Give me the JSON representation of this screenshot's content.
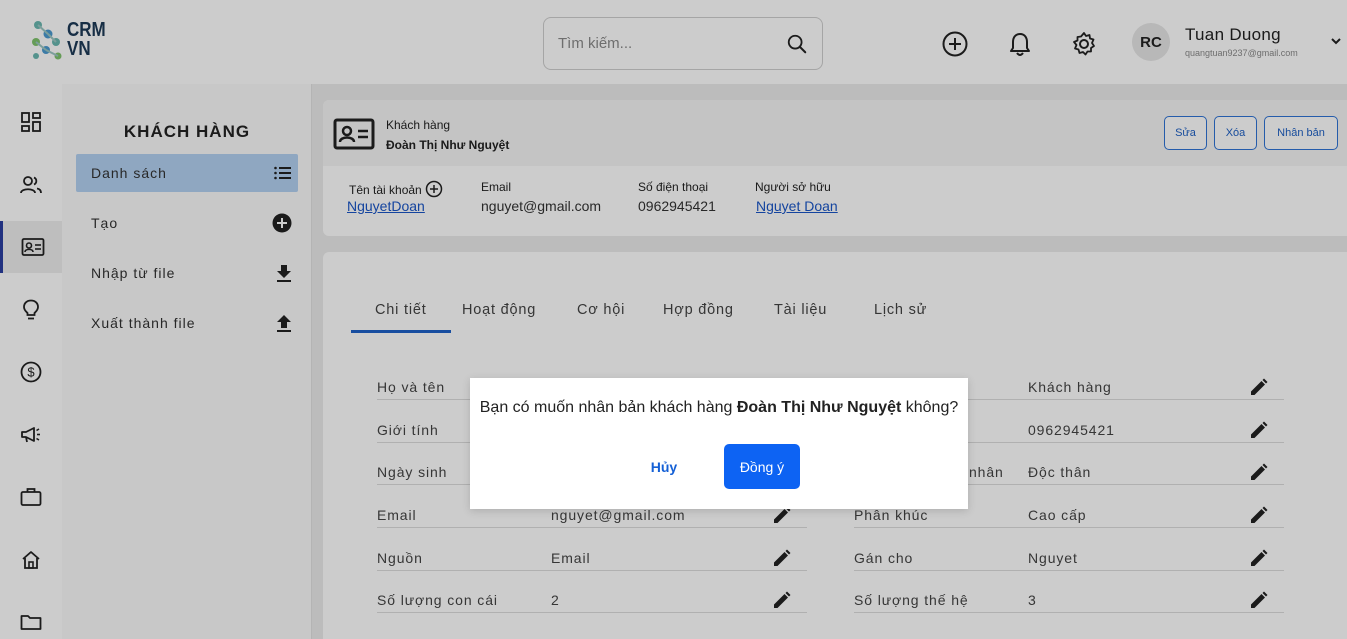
{
  "header": {
    "logo_line1": "CRM",
    "logo_line2": "VN",
    "search_placeholder": "Tìm kiếm...",
    "user": {
      "initials": "RC",
      "name": "Tuan Duong",
      "email": "quangtuan9237@gmail.com"
    },
    "icons": [
      "add-circle-icon",
      "bell-icon",
      "gear-icon",
      "chevron-down-icon",
      "search-icon"
    ]
  },
  "rail": {
    "icons": [
      "dashboard-icon",
      "users-icon",
      "contact-card-icon",
      "lightbulb-icon",
      "dollar-icon",
      "megaphone-icon",
      "briefcase-icon",
      "home-icon",
      "folder-icon"
    ],
    "active_index": 2
  },
  "sidemenu": {
    "title": "KHÁCH HÀNG",
    "items": [
      {
        "label": "Danh sách",
        "icon": "list-icon"
      },
      {
        "label": "Tạo",
        "icon": "add-filled-icon"
      },
      {
        "label": "Nhập từ file",
        "icon": "download-icon"
      },
      {
        "label": "Xuất thành file",
        "icon": "upload-icon"
      }
    ]
  },
  "customer": {
    "type_label": "Khách hàng",
    "name": "Đoàn Thị Như Nguyệt",
    "buttons": {
      "edit": "Sửa",
      "delete": "Xóa",
      "clone": "Nhân bản"
    },
    "info": {
      "account_label": "Tên tài khoản",
      "account_value": "NguyetDoan",
      "email_label": "Email",
      "email_value": "nguyet@gmail.com",
      "phone_label": "Số điện thoại",
      "phone_value": "0962945421",
      "owner_label": "Người sở hữu",
      "owner_value": "Nguyet Doan"
    }
  },
  "tabs": [
    "Chi tiết",
    "Hoạt động",
    "Cơ hội",
    "Hợp đồng",
    "Tài liệu",
    "Lịch sử"
  ],
  "details": {
    "left": [
      {
        "label": "Họ và tên",
        "value": ""
      },
      {
        "label": "Giới tính",
        "value": ""
      },
      {
        "label": "Ngày sinh",
        "value": ""
      },
      {
        "label": "Email",
        "value": "nguyet@gmail.com"
      },
      {
        "label": "Nguồn",
        "value": "Email"
      },
      {
        "label": "Số lượng con cái",
        "value": "2"
      }
    ],
    "right": [
      {
        "label": "",
        "value": "Khách hàng"
      },
      {
        "label": "",
        "value": "0962945421"
      },
      {
        "label": "nhân",
        "value": "Độc thân"
      },
      {
        "label": "Phân khúc",
        "value": "Cao cấp"
      },
      {
        "label": "Gán cho",
        "value": "Nguyet"
      },
      {
        "label": "Số lượng thế hệ",
        "value": "3"
      }
    ]
  },
  "modal": {
    "message_pre": "Bạn có muốn nhân bản khách hàng ",
    "message_name": "Đoàn Thị Như Nguyệt",
    "message_post": " không?",
    "cancel": "Hủy",
    "confirm": "Đồng ý"
  }
}
